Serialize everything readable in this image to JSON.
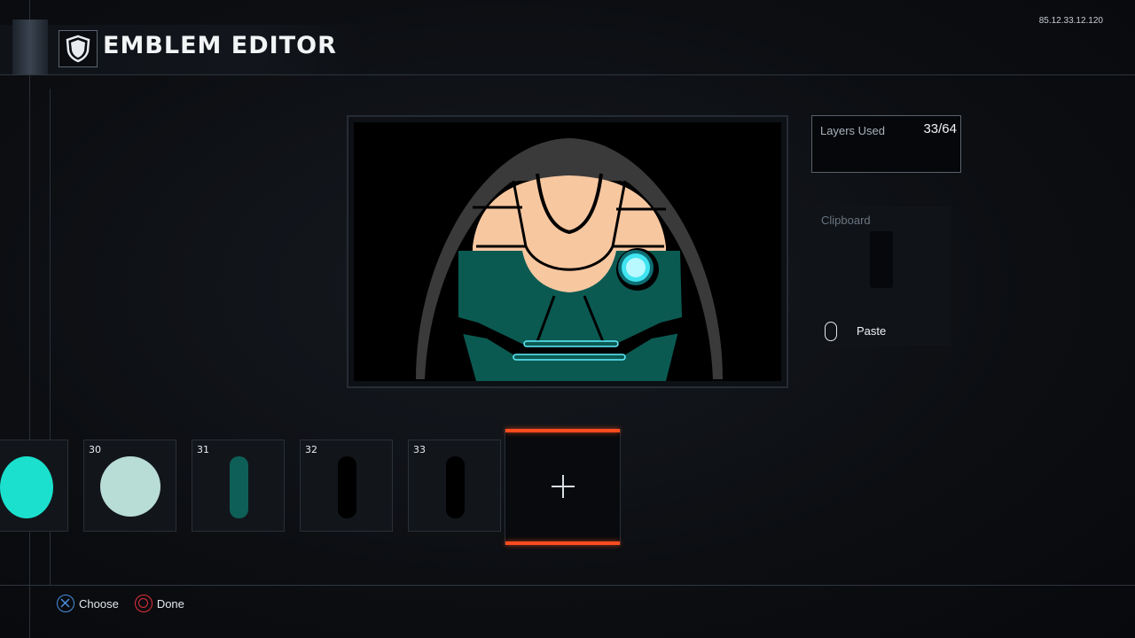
{
  "version": "85.12.33.12.120",
  "header": {
    "title": "EMBLEM EDITOR",
    "icon": "shield-icon"
  },
  "layers_panel": {
    "label": "Layers Used",
    "value": "33/64"
  },
  "clipboard_panel": {
    "label": "Clipboard",
    "paste_label": "Paste",
    "paste_button_icon": "touchpad-icon"
  },
  "layers": [
    {
      "number": "",
      "shape": "circle",
      "color": "#1be0cd"
    },
    {
      "number": "30",
      "shape": "circle",
      "color": "#b8dcd6"
    },
    {
      "number": "31",
      "shape": "capsule",
      "color": "#0e5f57"
    },
    {
      "number": "32",
      "shape": "capsule",
      "color": "#000000"
    },
    {
      "number": "33",
      "shape": "capsule",
      "color": "#000000"
    }
  ],
  "add_layer_icon": "plus-icon",
  "footer": [
    {
      "icon": "cross-button-icon",
      "label": "Choose",
      "color": "#4a8fe0"
    },
    {
      "icon": "circle-button-icon",
      "label": "Done",
      "color": "#e0303a"
    }
  ],
  "colors": {
    "accent": "#ff4c1e",
    "skin": "#f7c7a0",
    "armor": "#0b5a52",
    "hood": "#3a3a3a",
    "glow": "#5ff0ff"
  }
}
